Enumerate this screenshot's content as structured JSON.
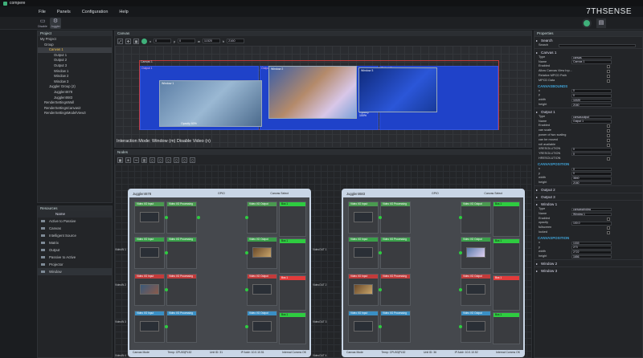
{
  "app": {
    "title": "compere",
    "brand": "7THSENSE"
  },
  "menu": [
    "File",
    "Panels",
    "Configuration",
    "Help"
  ],
  "toolbar": {
    "b1": "Disable",
    "b2": "Juggler"
  },
  "project": {
    "title": "Project",
    "items": [
      "My Project",
      "Group",
      "Canvas 1",
      "Output 1",
      "Output 2",
      "Output 3",
      "Window 1",
      "Window 2",
      "Window 3",
      "Juggler Group (2)",
      "Juggler4678",
      "Juggler4683",
      "RenderSettingsWall",
      "RenderSettingsCanvas2",
      "RenderSettingsModelView3"
    ]
  },
  "resources": {
    "title": "Resources",
    "header": "Name",
    "items": [
      "Active to Passive",
      "Canvas",
      "Intelligent Source",
      "Matrix",
      "Output",
      "Passive to Active",
      "Projector",
      "Window"
    ]
  },
  "canvas": {
    "title": "Canvas",
    "fields": [
      "0",
      "0",
      "11520",
      "2160"
    ],
    "canvas_label": "Canvas 1",
    "outputs": [
      "Output 1",
      "Output 2",
      "Output 3"
    ],
    "windows": [
      "Window 1",
      "Window 2",
      "Window 3"
    ],
    "opacity1": "Opacity 60%",
    "opacity2": "Opacity 100%",
    "mode": "Interaction Mode: Window (m) Disable Video (n)"
  },
  "nodes": {
    "title": "Nodes",
    "jugglers": [
      {
        "name": "Juggler4678",
        "gpio": "GPIO",
        "canvas_select": "Canvas Select",
        "footer": [
          "Canvas Mode",
          "Temp: CPU53|PL52",
          "Unit ID: 31",
          "IP Addr: 10.0.10.51",
          "Internal Comms OK"
        ]
      },
      {
        "name": "Juggler4683",
        "gpio": "GPIO",
        "canvas_select": "Canvas Select",
        "footer": [
          "Canvas Mode",
          "Temp: CPU53|PL52",
          "Unit ID: 36",
          "IP Addr: 10.0.10.52",
          "Internal Comms OK"
        ]
      }
    ],
    "block_labels": {
      "input": "Video I/O Input",
      "proc": "Video I/O Processing",
      "output": "Video I/O Output",
      "bus": "Bus 1"
    },
    "side_labels": [
      "VideoIN 1",
      "VideoIN 2",
      "VideoIN 3",
      "VideoIN 4",
      "VideoOUT 1",
      "VideoOUT 2",
      "VideoOUT 3",
      "VideoOUT 4"
    ]
  },
  "properties": {
    "title": "Properties",
    "search_label": "Search",
    "search_field": "Search",
    "sections": {
      "canvas1": "Canvas 1",
      "output1": "Output 1",
      "output2": "Output 2",
      "output3": "Output 3",
      "window1": "Window 1",
      "window2": "Window 2",
      "window3": "Window 3"
    },
    "canvas_rows": [
      {
        "k": "Type",
        "v": "canvas"
      },
      {
        "k": "Name",
        "v": "Canvas 1"
      },
      {
        "k": "Enabled",
        "v": ""
      },
      {
        "k": "Allow Canvas View Inp...",
        "v": ""
      },
      {
        "k": "Relative MPCD Path",
        "v": ""
      },
      {
        "k": "MPCD Data",
        "v": ""
      }
    ],
    "canvas_bounds_title": "CANVASBOUNDS",
    "canvas_bounds": [
      {
        "k": "x",
        "v": "0"
      },
      {
        "k": "y",
        "v": "0"
      },
      {
        "k": "width",
        "v": "11520"
      },
      {
        "k": "height",
        "v": "2160"
      }
    ],
    "output_rows": [
      {
        "k": "Type",
        "v": "canvasoutput"
      },
      {
        "k": "Name",
        "v": "Output 1"
      },
      {
        "k": "Enabled",
        "v": ""
      },
      {
        "k": "can scale",
        "v": ""
      },
      {
        "k": "power of two scaling",
        "v": ""
      },
      {
        "k": "can be moved",
        "v": ""
      },
      {
        "k": "roll available",
        "v": ""
      },
      {
        "k": "XRESOLUTION",
        "v": "0"
      },
      {
        "k": "YRESOLUTION",
        "v": "0"
      },
      {
        "k": "HRESOLUTION",
        "v": ""
      }
    ],
    "canvas_position_title": "CANVASPOSITION",
    "output_position": [
      {
        "k": "x",
        "v": "0"
      },
      {
        "k": "y",
        "v": "0"
      },
      {
        "k": "width",
        "v": "3840"
      },
      {
        "k": "height",
        "v": "2160"
      }
    ],
    "window_rows": [
      {
        "k": "Type",
        "v": "canvaswindow"
      },
      {
        "k": "Name",
        "v": "Window 1"
      },
      {
        "k": "Enabled",
        "v": ""
      },
      {
        "k": "opacity",
        "v": "100.0"
      },
      {
        "k": "fullscreen",
        "v": ""
      },
      {
        "k": "locked",
        "v": ""
      }
    ],
    "window_position": [
      {
        "k": "x",
        "v": "1333"
      },
      {
        "k": "y",
        "v": "273"
      },
      {
        "k": "width",
        "v": "2722"
      },
      {
        "k": "height",
        "v": "1656"
      }
    ]
  },
  "colors": {
    "accent": "#3fb07a",
    "canvas_border": "#c23b3b",
    "output_fill": "#1f42c9",
    "node_frame": "#c9d6e6"
  }
}
